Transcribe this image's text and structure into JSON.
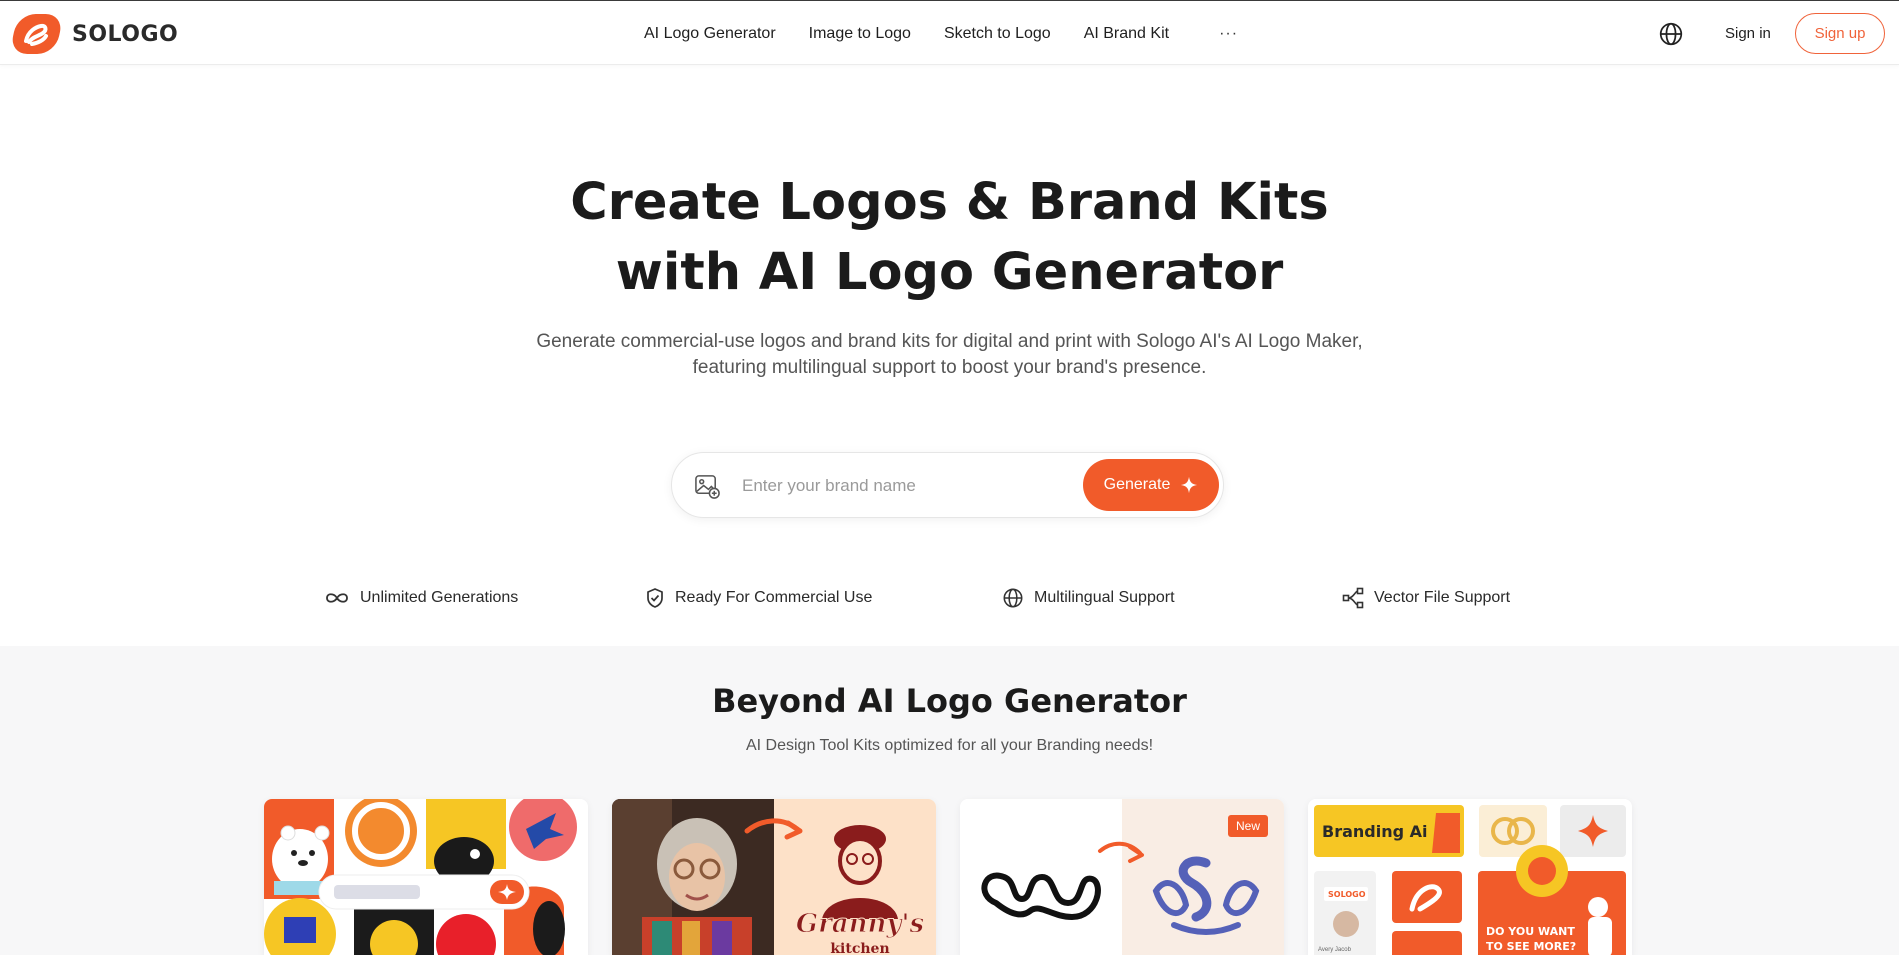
{
  "brand": {
    "name": "SOLOGO",
    "accent_color": "#f15b2a"
  },
  "nav": {
    "items": [
      {
        "label": "AI Logo Generator"
      },
      {
        "label": "Image to Logo"
      },
      {
        "label": "Sketch to Logo"
      },
      {
        "label": "AI Brand Kit"
      }
    ],
    "more_label": "···",
    "language_icon": "globe-icon",
    "sign_in": "Sign in",
    "sign_up": "Sign up"
  },
  "hero": {
    "title_line1": "Create Logos & Brand Kits",
    "title_line2": "with AI Logo Generator",
    "subtitle_line1": "Generate commercial-use logos and brand kits for digital and print with Sologo AI's AI Logo Maker,",
    "subtitle_line2": "featuring multilingual support to boost your brand's presence."
  },
  "search": {
    "placeholder": "Enter your brand name",
    "value": "",
    "image_icon": "image-upload-icon",
    "button_label": "Generate",
    "button_icon": "sparkle-icon"
  },
  "features": [
    {
      "label": "Unlimited Generations",
      "icon": "infinity-icon"
    },
    {
      "label": "Ready For Commercial Use",
      "icon": "shield-check-icon"
    },
    {
      "label": "Multilingual Support",
      "icon": "globe-icon"
    },
    {
      "label": "Vector File Support",
      "icon": "vector-nodes-icon"
    }
  ],
  "beyond": {
    "title": "Beyond AI Logo Generator",
    "subtitle": "AI Design Tool Kits optimized for all your Branding needs!",
    "cards": [
      {
        "name": "ai-logo-generator-card"
      },
      {
        "name": "image-to-logo-card",
        "logo_text_1": "Granny's",
        "logo_text_2": "kitchen"
      },
      {
        "name": "sketch-to-logo-card",
        "badge": "New"
      },
      {
        "name": "ai-brand-kit-card",
        "tile_text": "Branding Ai",
        "mini_logo": "SOLOGO",
        "promo_line1": "DO YOU WANT",
        "promo_line2": "TO SEE MORE?",
        "avatar_caption": "Avery Jacob"
      }
    ]
  }
}
